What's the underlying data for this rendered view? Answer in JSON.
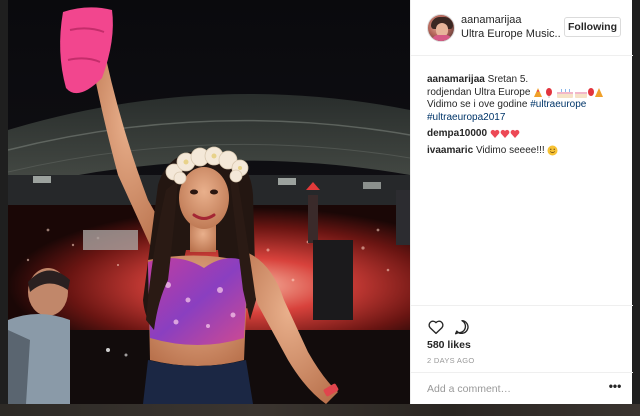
{
  "post": {
    "username": "aanamarijaa",
    "location": "Ultra Europe Music..",
    "follow_label": "Following"
  },
  "comments": [
    {
      "user": "aanamarijaa",
      "line1": "Sretan 5.",
      "line2": "rodjendan Ultra Europe",
      "line3": "Vidimo se i ove godine",
      "hashtag1": "#ultraeurope",
      "hashtag2": "#ultraeuropa2017"
    },
    {
      "user": "dempa10000"
    },
    {
      "user": "ivaamaric",
      "text": "Vidimo seeee!!!"
    }
  ],
  "actions": {
    "likes": "580 likes",
    "time": "2 DAYS AGO"
  },
  "add_comment": {
    "placeholder": "Add a comment…",
    "more": "•••"
  },
  "colors": {
    "hashtag": "#003569",
    "heart": "#ed4956",
    "border": "#efefef"
  },
  "icons": [
    "heart-outline-icon",
    "comment-bubble-icon",
    "more-options-icon"
  ]
}
